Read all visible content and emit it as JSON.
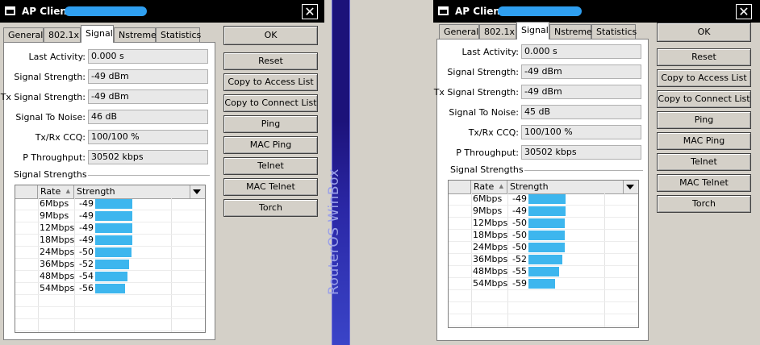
{
  "windows": [
    {
      "title": "AP Client",
      "tabs": [
        "General",
        "802.1x",
        "Signal",
        "Nstreme",
        "Statistics"
      ],
      "active_tab": "Signal",
      "fields": [
        {
          "label": "Last Activity:",
          "value": "0.000 s"
        },
        {
          "label": "Signal Strength:",
          "value": "-49 dBm"
        },
        {
          "label": "Tx Signal Strength:",
          "value": "-49 dBm"
        },
        {
          "label": "Signal To Noise:",
          "value": "46 dB"
        },
        {
          "label": "Tx/Rx CCQ:",
          "value": "100/100 %"
        },
        {
          "label": "P Throughput:",
          "value": "30502 kbps"
        }
      ],
      "group_label": "Signal Strengths",
      "columns": [
        "Rate",
        "Strength"
      ],
      "rows": [
        {
          "rate": "6Mbps",
          "strength": "-49",
          "dbm": -49
        },
        {
          "rate": "9Mbps",
          "strength": "-49",
          "dbm": -49
        },
        {
          "rate": "12Mbps",
          "strength": "-49",
          "dbm": -49
        },
        {
          "rate": "18Mbps",
          "strength": "-49",
          "dbm": -49
        },
        {
          "rate": "24Mbps",
          "strength": "-50",
          "dbm": -50
        },
        {
          "rate": "36Mbps",
          "strength": "-52",
          "dbm": -52
        },
        {
          "rate": "48Mbps",
          "strength": "-54",
          "dbm": -54
        },
        {
          "rate": "54Mbps",
          "strength": "-56",
          "dbm": -56
        }
      ],
      "buttons": [
        "OK",
        "Reset",
        "Copy to Access List",
        "Copy to Connect List",
        "Ping",
        "MAC Ping",
        "Telnet",
        "MAC Telnet",
        "Torch"
      ]
    },
    {
      "title": "AP Client",
      "tabs": [
        "General",
        "802.1x",
        "Signal",
        "Nstreme",
        "Statistics"
      ],
      "active_tab": "Signal",
      "fields": [
        {
          "label": "Last Activity:",
          "value": "0.000 s"
        },
        {
          "label": "Signal Strength:",
          "value": "-49 dBm"
        },
        {
          "label": "Tx Signal Strength:",
          "value": "-49 dBm"
        },
        {
          "label": "Signal To Noise:",
          "value": "45 dB"
        },
        {
          "label": "Tx/Rx CCQ:",
          "value": "100/100 %"
        },
        {
          "label": "P Throughput:",
          "value": "30502 kbps"
        }
      ],
      "group_label": "Signal Strengths",
      "columns": [
        "Rate",
        "Strength"
      ],
      "rows": [
        {
          "rate": "6Mbps",
          "strength": "-49",
          "dbm": -49
        },
        {
          "rate": "9Mbps",
          "strength": "-49",
          "dbm": -49
        },
        {
          "rate": "12Mbps",
          "strength": "-50",
          "dbm": -50
        },
        {
          "rate": "18Mbps",
          "strength": "-50",
          "dbm": -50
        },
        {
          "rate": "24Mbps",
          "strength": "-50",
          "dbm": -50
        },
        {
          "rate": "36Mbps",
          "strength": "-52",
          "dbm": -52
        },
        {
          "rate": "48Mbps",
          "strength": "-55",
          "dbm": -55
        },
        {
          "rate": "54Mbps",
          "strength": "-59",
          "dbm": -59
        }
      ],
      "buttons": [
        "OK",
        "Reset",
        "Copy to Access List",
        "Copy to Connect List",
        "Ping",
        "MAC Ping",
        "Telnet",
        "MAC Telnet",
        "Torch"
      ]
    }
  ],
  "sidebar": {
    "text": "RouterOS WinBox"
  },
  "colors": {
    "bar": "#3db6ee",
    "redaction": "#2f9ff0",
    "sidebar": "#1c127a"
  },
  "icons": {
    "title_icon": "window-icon",
    "close": "close-icon",
    "dropdown": "dropdown-arrow-icon",
    "sort": "sort-arrow-icon"
  }
}
